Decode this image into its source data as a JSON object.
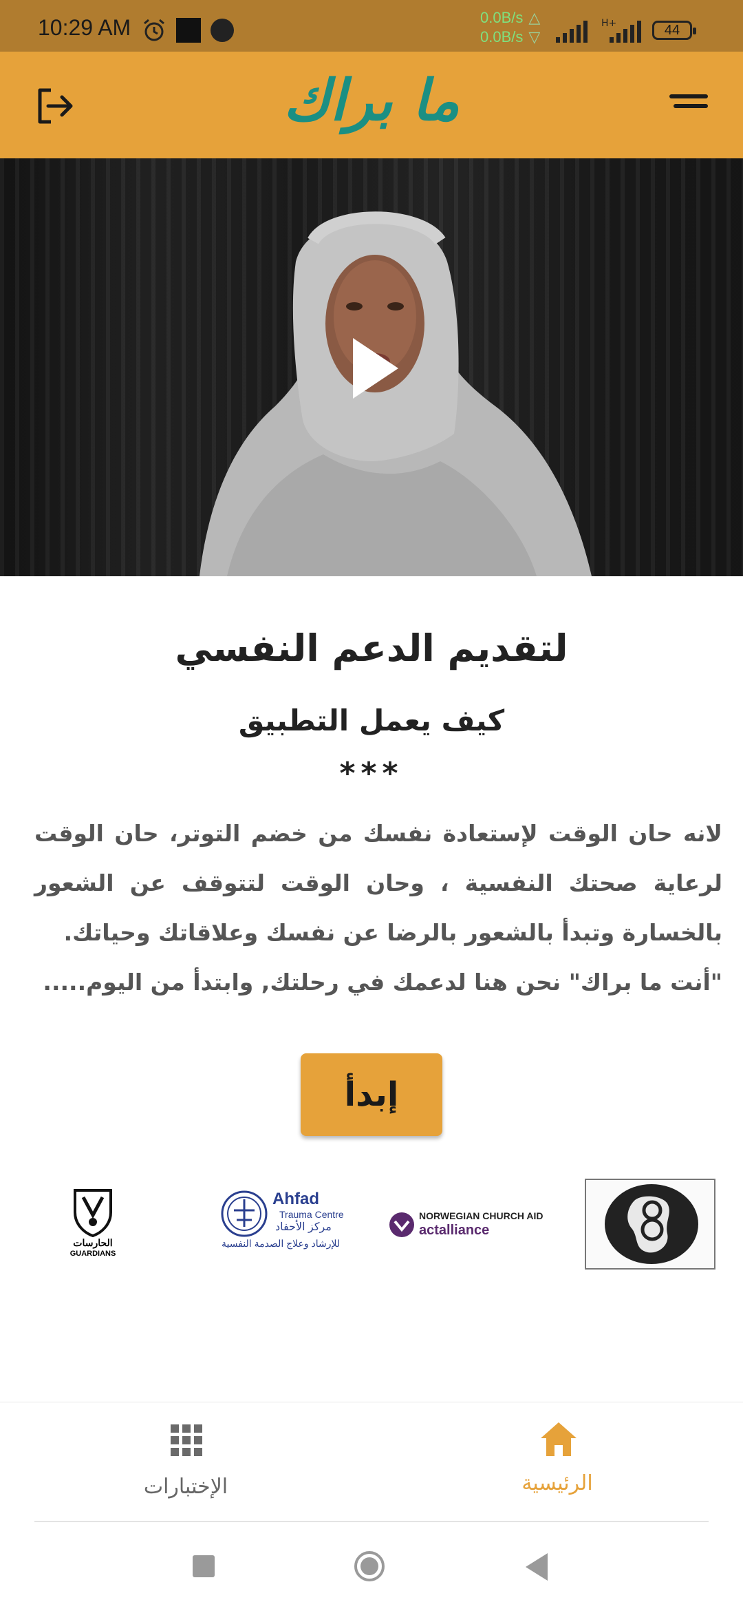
{
  "status_bar": {
    "time": "10:29 AM",
    "net_up": "0.0B/s",
    "net_down": "0.0B/s",
    "network_type": "H+",
    "battery": "44"
  },
  "header": {
    "title": "ما براك",
    "logout_icon": "logout-icon",
    "menu_icon": "menu-icon"
  },
  "video": {
    "play_icon": "play-icon"
  },
  "content": {
    "heading": "لتقديم الدعم النفسي",
    "subheading": "كيف يعمل التطبيق",
    "stars": "***",
    "paragraph1": "لانه حان الوقت لإستعادة نفسك من خضم التوتر، حان الوقت لرعاية صحتك النفسية ، وحان الوقت لتتوقف عن الشعور بالخسارة وتبدأ بالشعور بالرضا عن نفسك وعلاقاتك وحياتك.",
    "paragraph2": "\"أنت ما براك\" نحن هنا لدعمك في رحلتك, وابتدأ من اليوم.....",
    "start_button": "إبدأ"
  },
  "partners": {
    "guardians_ar": "الحارسات",
    "guardians_en": "GUARDIANS",
    "ahfad_en": "Ahfad",
    "ahfad_sub": "Trauma Centre",
    "ahfad_ar1": "مركز الأحفاد",
    "ahfad_ar2": "للإرشاد وعلاج الصدمة النفسية",
    "nca_line1": "NORWEGIAN CHURCH AID",
    "nca_line2": "actalliance"
  },
  "bottom_nav": {
    "tests_label": "الإختبارات",
    "home_label": "الرئيسية"
  },
  "colors": {
    "accent": "#e6a23a",
    "title_teal": "#1b8f83",
    "status_bar": "#b07c2f"
  }
}
